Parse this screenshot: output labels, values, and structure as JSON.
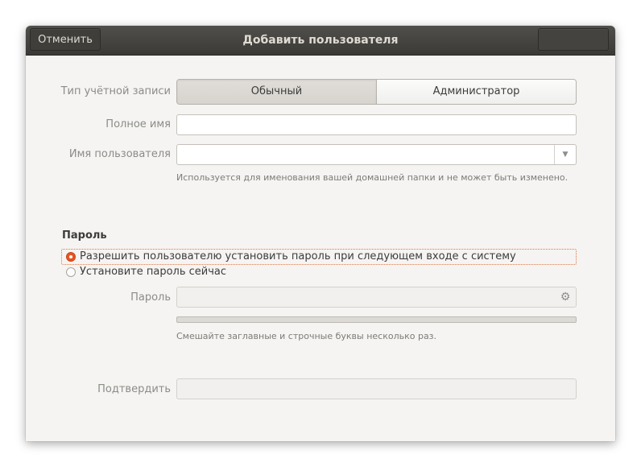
{
  "window": {
    "title": "Добавить пользователя",
    "cancel_label": "Отменить",
    "add_label": ""
  },
  "account_type": {
    "label": "Тип учётной записи",
    "options": [
      "Обычный",
      "Администратор"
    ],
    "selected": "Обычный"
  },
  "full_name": {
    "label": "Полное имя",
    "value": ""
  },
  "username": {
    "label": "Имя пользователя",
    "value": "",
    "hint": "Используется для именования вашей домашней папки и не может быть изменено."
  },
  "password": {
    "section_title": "Пароль",
    "option_later": "Разрешить пользователю установить пароль при следующем входе с систему",
    "option_now": "Установите пароль сейчас",
    "selected_option": "option_later",
    "field_label": "Пароль",
    "field_value": "",
    "strength_level": 0,
    "hint": "Смешайте заглавные и строчные буквы несколько раз."
  },
  "confirm": {
    "label": "Подтвердить",
    "value": ""
  },
  "colors": {
    "accent": "#e95420",
    "titlebar": "#3f3e3a",
    "background": "#f5f4f2"
  },
  "icons": {
    "password_generate": "gear-icon",
    "combo": "chevron-down-icon"
  }
}
